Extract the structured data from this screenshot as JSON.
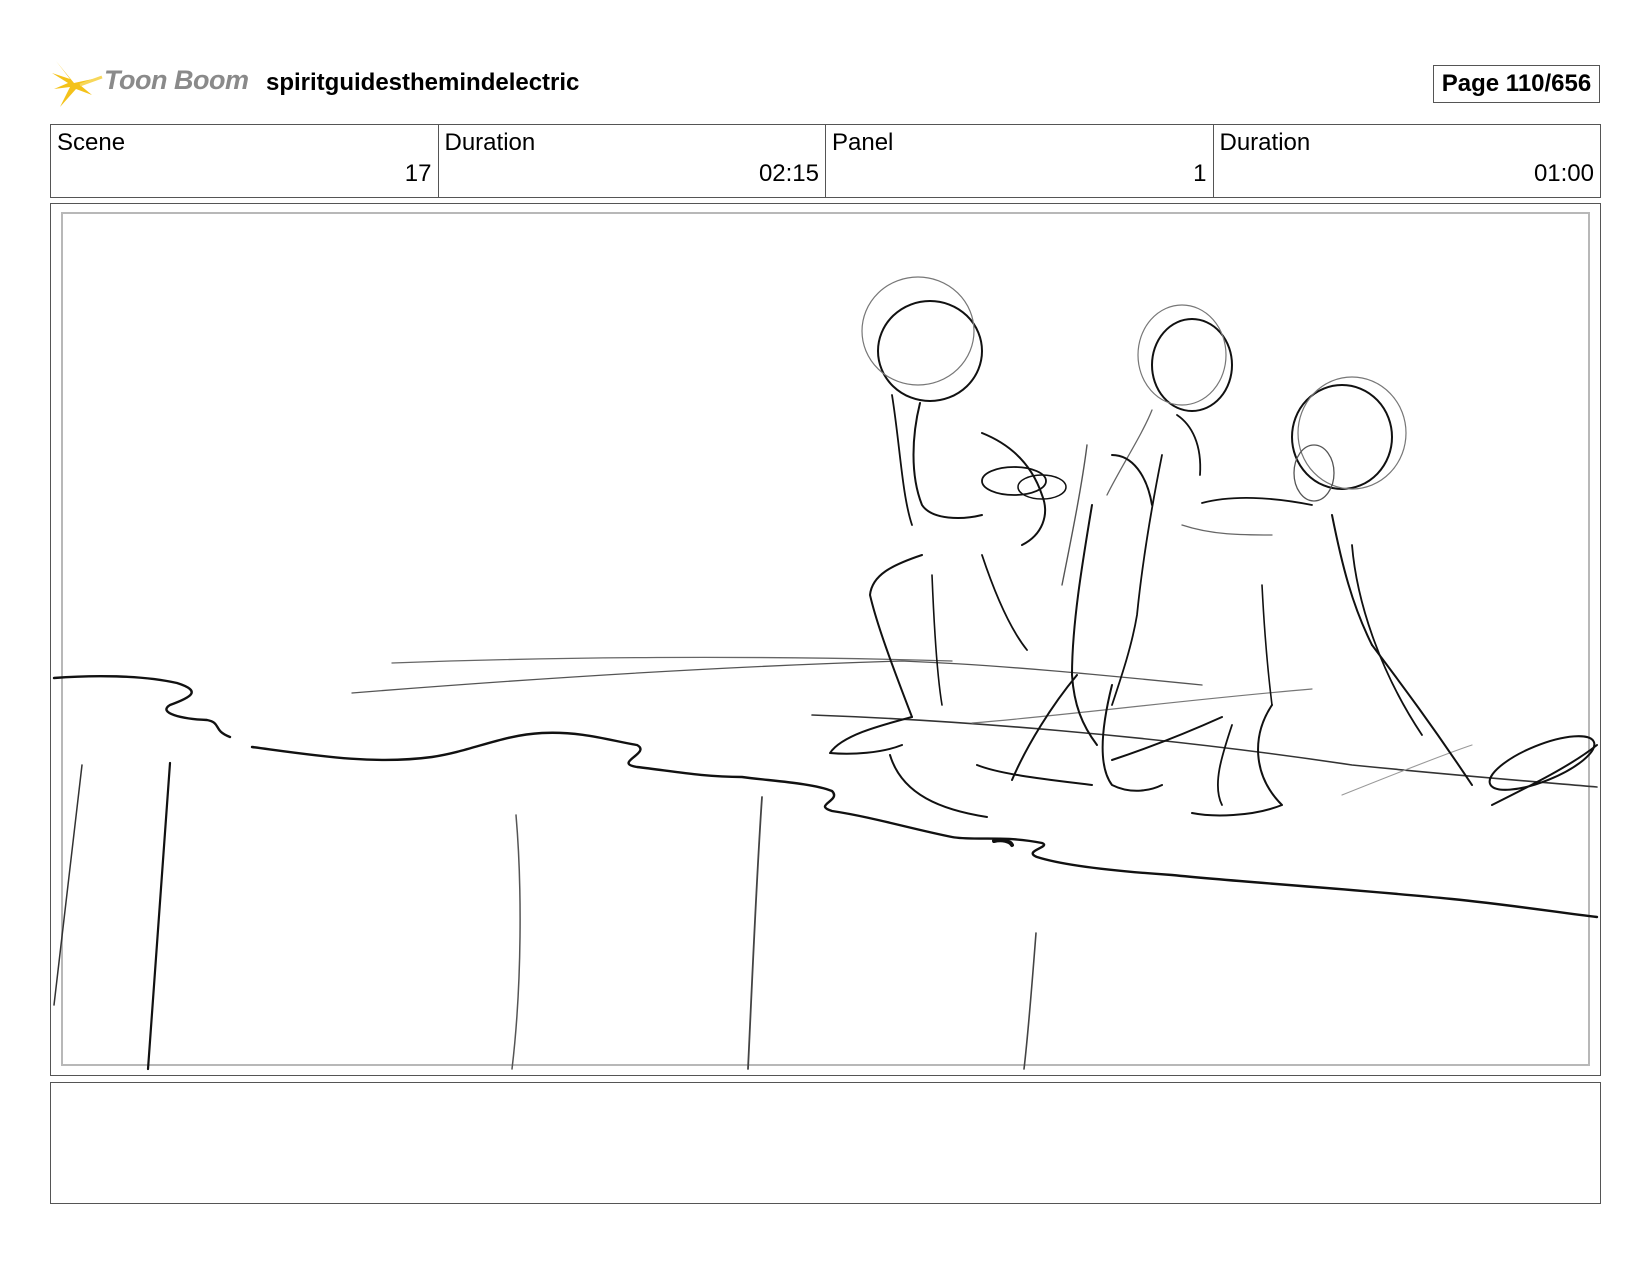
{
  "header": {
    "logo_text": "Toon Boom",
    "project_title": "spiritguidesthemindelectric",
    "page_indicator": "Page 110/656"
  },
  "info": {
    "scene_label": "Scene",
    "scene_value": "17",
    "scene_duration_label": "Duration",
    "scene_duration_value": "02:15",
    "panel_label": "Panel",
    "panel_value": "1",
    "panel_duration_label": "Duration",
    "panel_duration_value": "01:00"
  },
  "notes": {
    "text": ""
  },
  "colors": {
    "logo_accent": "#f4c21a",
    "logo_text": "#8a8a8a",
    "border": "#555555",
    "sketch_line": "#111111"
  }
}
